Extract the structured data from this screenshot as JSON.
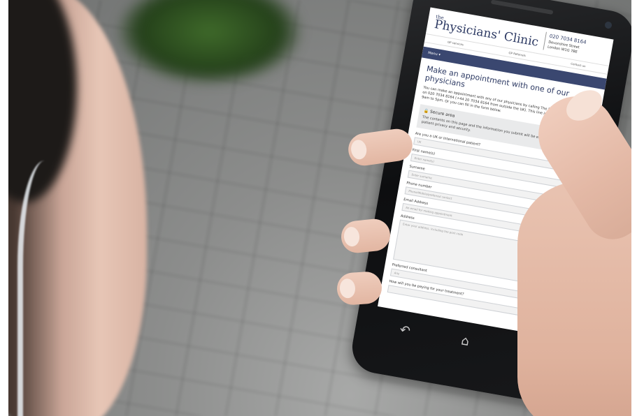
{
  "site": {
    "logo_the": "the",
    "logo_name": "Physicians' Clinic",
    "phone": "020 7034 8164",
    "address_line1": "Devonshire Street",
    "address_line2": "London W1G 7BE"
  },
  "nav": {
    "links": [
      "GP services",
      "GP Referrals",
      "Contact us"
    ],
    "menu_label": "Menu"
  },
  "page": {
    "title": "Make an appointment with one of our physicians",
    "intro": "You can make an appointment with any of our physicians by calling The Physicians' Clinic direct on 020 7034 8164 (+44 20 7034 8164 from outside the UK). This line is open Monday to Friday 9am to 5pm. Or you can fill in the form below."
  },
  "secure": {
    "title": "Secure area",
    "text": "The contents on this page and the information you submit will be encrypted in the interest of patient privacy and security."
  },
  "form": {
    "fields": [
      {
        "label": "Are you a UK or International patient?",
        "placeholder": "UK"
      },
      {
        "label": "First name(s)",
        "placeholder": "Enter name(s)"
      },
      {
        "label": "Surname",
        "placeholder": "Enter surname"
      },
      {
        "label": "Phone number",
        "placeholder": "Phone/Mobile/preferred contact"
      },
      {
        "label": "Email Address",
        "placeholder": "An email for making appointment"
      },
      {
        "label": "Address",
        "placeholder": "Enter your address, including the post code"
      },
      {
        "label": "Preferred consultant",
        "placeholder": "Any"
      },
      {
        "label": "How will you be paying for your treatment?",
        "placeholder": ""
      }
    ]
  },
  "icons": {
    "back": "back-icon",
    "home": "home-icon",
    "recent": "recent-apps-icon",
    "lock": "lock-icon",
    "chevron": "chevron-down-icon"
  }
}
